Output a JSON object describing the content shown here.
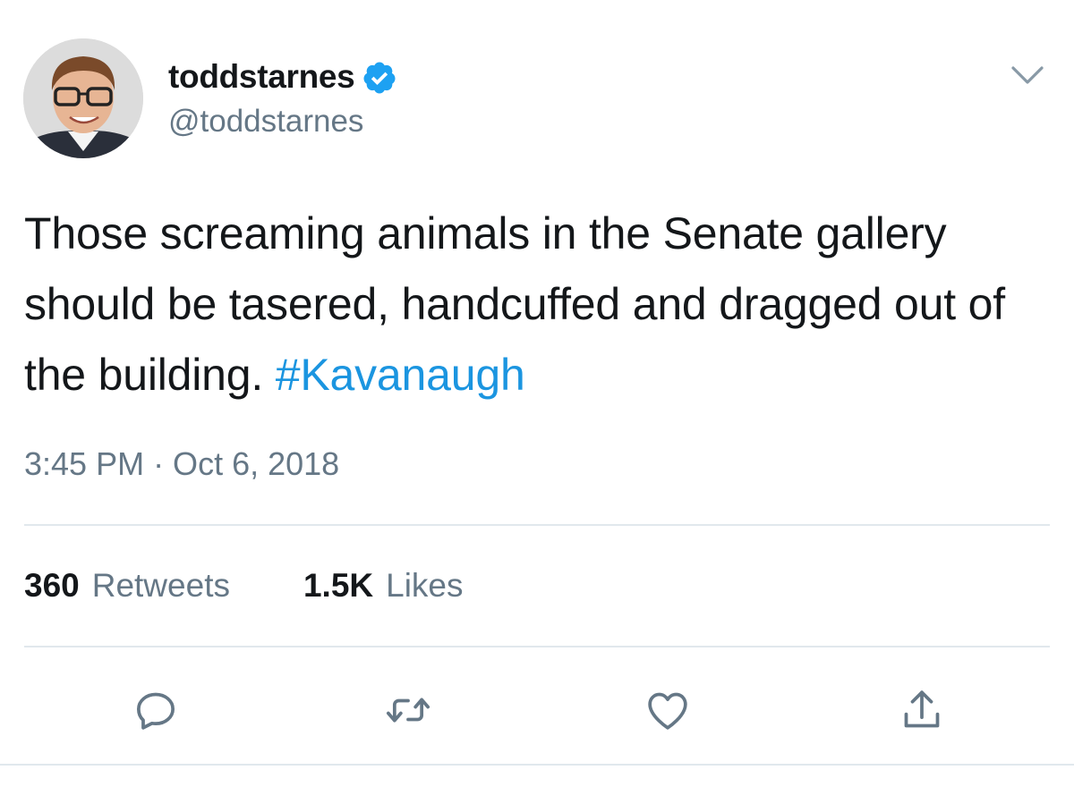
{
  "author": {
    "display_name": "toddstarnes",
    "handle": "@toddstarnes",
    "verified": true,
    "avatar_icon": "profile-photo"
  },
  "tweet": {
    "text": "Those screaming animals in the Senate gallery should be tasered, handcuffed and dragged out of the building. ",
    "hashtag": "#Kavanaugh",
    "timestamp": "3:45 PM · Oct 6, 2018"
  },
  "stats": {
    "retweets_count": "360",
    "retweets_label": "Retweets",
    "likes_count": "1.5K",
    "likes_label": "Likes"
  },
  "actions": {
    "reply_icon": "reply-icon",
    "retweet_icon": "retweet-icon",
    "like_icon": "heart-icon",
    "share_icon": "share-icon",
    "menu_icon": "chevron-down-icon"
  },
  "colors": {
    "accent": "#1b95e0",
    "verified_badge": "#1da1f2",
    "secondary_text": "#657786",
    "divider": "#e1e8ed"
  }
}
